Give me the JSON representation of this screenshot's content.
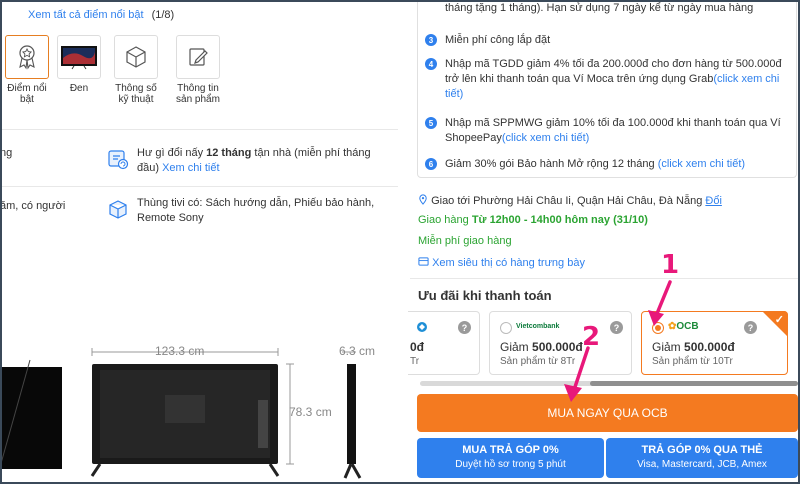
{
  "left": {
    "view_all": "Xem tất cả điểm nổi bật",
    "view_count": "(1/8)",
    "thumbnails": [
      {
        "label": "Điểm nổi bật",
        "icon": "award-icon"
      },
      {
        "label": "Đen",
        "icon": "tv-color-icon"
      },
      {
        "label": "Thông số kỹ thuật",
        "icon": "box-3d-icon"
      },
      {
        "label": "Thông tin sản phẩm",
        "icon": "edit-icon"
      }
    ],
    "row1_cut": "ng",
    "row2_cut": "ăm, có người",
    "warranty_text_pre": "Hư gì đổi nấy ",
    "warranty_bold": "12 tháng",
    "warranty_text_post": " tận nhà (miễn phí tháng đầu) ",
    "warranty_link": "Xem chi tiết",
    "box_text": "Thùng tivi có: Sách hướng dẫn, Phiếu bảo hành, Remote Sony",
    "dim_width": "123.3 cm",
    "dim_height": "78.3 cm",
    "dim_depth": "6.3 cm"
  },
  "right": {
    "promo_top": "tháng tặng 1 tháng). Hạn sử dụng 7 ngày kể từ ngày mua hàng",
    "promos": [
      {
        "num": "3",
        "text": "Miễn phí công lắp đặt",
        "link": ""
      },
      {
        "num": "4",
        "text": "Nhập mã TGDD giảm 4% tối đa 200.000đ cho đơn hàng từ 500.000đ trở lên khi thanh toán qua Ví Moca trên ứng dụng Grab",
        "link": "(click xem chi tiết)"
      },
      {
        "num": "5",
        "text": "Nhập mã SPPMWG giảm 10% tối đa 100.000đ khi thanh toán qua Ví ShopeePay",
        "link": "(click xem chi tiết)"
      },
      {
        "num": "6",
        "text": "Giảm 30% gói Bảo hành Mở rộng 12 tháng ",
        "link": "(click xem chi tiết)"
      }
    ],
    "ship_to": "Giao tới Phường Hải Châu Ii, Quận Hải Châu, Đà Nẵng ",
    "ship_change": "Đổi",
    "delivery_pre": "Giao hàng ",
    "delivery_bold": "Từ 12h00 - 14h00 hôm nay (31/10)",
    "free_ship": "Miễn phí giao hàng",
    "store_link": "Xem siêu thị có hàng trưng bày",
    "pay_title": "Ưu đãi khi thanh toán",
    "cards": [
      {
        "bank": "",
        "discount_pre": "",
        "discount": "0đ",
        "min": "Tr",
        "selected": false
      },
      {
        "bank": "Vietcombank",
        "discount_pre": "Giảm ",
        "discount": "500.000đ",
        "min": "Sản phẩm từ 8Tr",
        "selected": false
      },
      {
        "bank": "OCB",
        "discount_pre": "Giảm ",
        "discount": "500.000đ",
        "min": "Sản phẩm từ 10Tr",
        "selected": true
      }
    ],
    "buy_now": "MUA NGAY QUA OCB",
    "installment": {
      "title": "MUA TRẢ GÓP 0%",
      "sub": "Duyệt hồ sơ trong 5 phút"
    },
    "card_installment": {
      "title": "TRẢ GÓP 0% QUA THẺ",
      "sub": "Visa, Mastercard, JCB, Amex"
    }
  },
  "annotations": {
    "one": "1",
    "two": "2"
  },
  "colors": {
    "accent": "#f47a20",
    "link": "#2f80ed",
    "green": "#2ba432",
    "annotation": "#e8187a"
  }
}
